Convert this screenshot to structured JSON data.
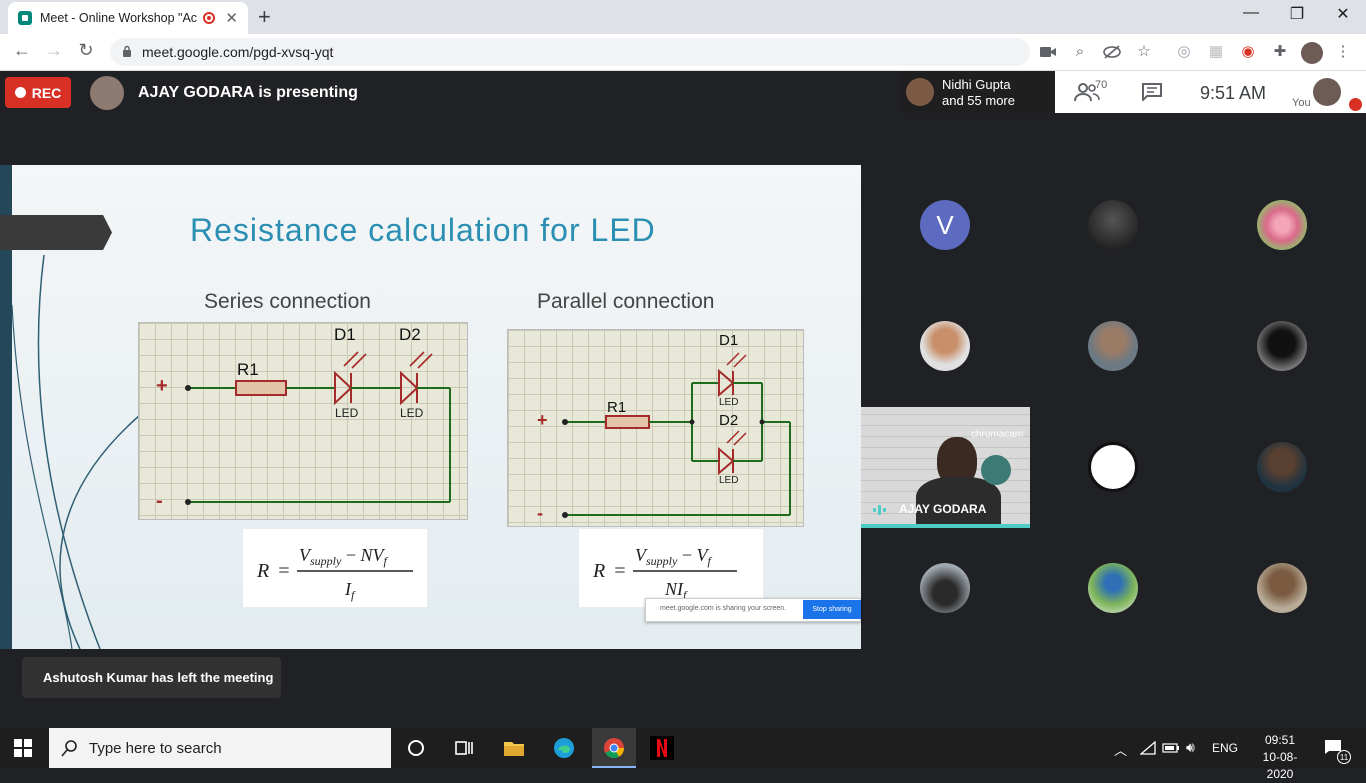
{
  "browser": {
    "tab_title": "Meet - Online Workshop \"Ac",
    "new_tab_symbol": "+",
    "url": "meet.google.com/pgd-xvsq-yqt",
    "minimize": "—",
    "restore": "❐",
    "close": "✕"
  },
  "meet": {
    "rec_label": "REC",
    "presenting_text": "AJAY GODARA is presenting",
    "others_line1": "Nidhi Gupta",
    "others_line2": "and 55 more",
    "participant_count": "70",
    "time": "9:51  AM",
    "you_label": "You",
    "toast": "Ashutosh Kumar has left the meeting",
    "tile_name": "AJAY GODARA",
    "tile_watermark": "chromacam",
    "avatar_v_letter": "V"
  },
  "slide": {
    "title": "Resistance calculation for LED",
    "series_heading": "Series connection",
    "parallel_heading": "Parallel connection",
    "plus": "+",
    "minus": "-",
    "r1": "R1",
    "d1": "D1",
    "d2": "D2",
    "led": "LED",
    "share_notice": "meet.google.com is sharing your screen.",
    "stop_sharing": "Stop sharing"
  },
  "taskbar": {
    "search_placeholder": "Type here to search",
    "lang": "ENG",
    "clock_time": "09:51",
    "clock_date": "10-08-2020",
    "notif_count": "11"
  },
  "colors": {
    "rec_red": "#d93025",
    "title_blue": "#2a8fb3",
    "speaking_teal": "#4ecdc4",
    "circuit_red": "#a52a2a",
    "circuit_green": "#1e6b1e"
  }
}
